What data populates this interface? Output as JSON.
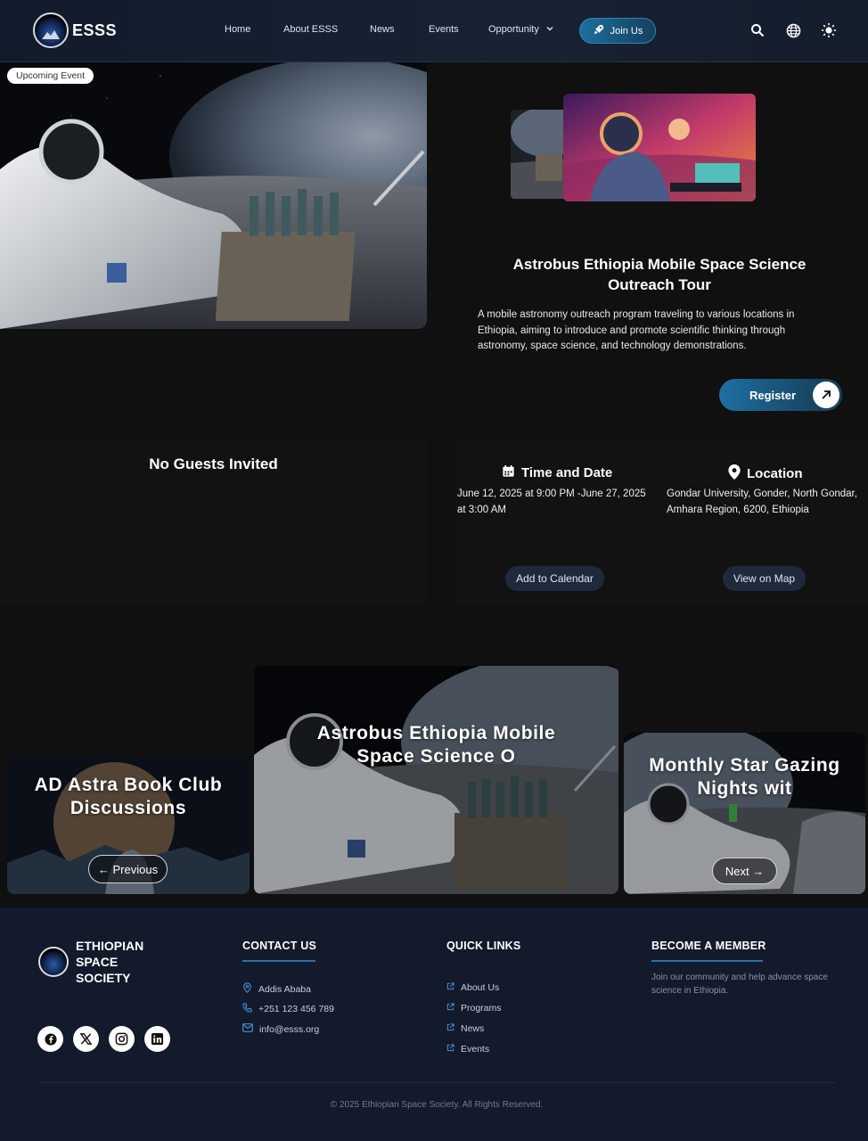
{
  "nav": {
    "brand": "ESSS",
    "links": [
      "Home",
      "About ESSS",
      "News",
      "Events",
      "Opportunity"
    ],
    "join_label": "Join Us",
    "icons": [
      "search-icon",
      "globe-icon",
      "sun-icon"
    ]
  },
  "hero": {
    "badge": "Upcoming Event",
    "title": "Astrobus Ethiopia Mobile Space Science Outreach Tour",
    "description": "A mobile astronomy outreach program traveling to various locations in Ethiopia, aiming to introduce and promote scientific thinking through astronomy, space science, and technology demonstrations.",
    "register_label": "Register"
  },
  "guests": {
    "title": "No Guests Invited"
  },
  "details": {
    "time_heading": "Time and Date",
    "time_value": "June 12, 2025 at 9:00 PM -June 27, 2025 at 3:00 AM",
    "location_heading": "Location",
    "location_value": "Gondar University, Gonder, North Gondar, Amhara Region, 6200, Ethiopia",
    "calendar_button": "Add to Calendar",
    "map_button": "View on Map"
  },
  "carousel": {
    "slides": [
      {
        "title": "AD Astra Book Club Discussions"
      },
      {
        "title": "Astrobus Ethiopia Mobile Space Science O"
      },
      {
        "title": "Monthly Star Gazing Nights wit"
      }
    ],
    "prev_label": "← Previous",
    "next_label": "Next →"
  },
  "footer": {
    "brand_line1": "ETHIOPIAN",
    "brand_line2": "SPACE",
    "brand_line3": "SOCIETY",
    "social": [
      "facebook-icon",
      "x-icon",
      "instagram-icon",
      "linkedin-icon"
    ],
    "contact_heading": "CONTACT US",
    "contact": {
      "address": "Addis Ababa",
      "phone": "+251 123 456 789",
      "email": "info@esss.org"
    },
    "links_heading": "QUICK LINKS",
    "links": [
      "About Us",
      "Programs",
      "News",
      "Events"
    ],
    "member_heading": "BECOME A MEMBER",
    "member_text": "Join our community and help advance space science in Ethiopia.",
    "copyright": "© 2025 Ethiopian Space Society. All Rights Reserved."
  },
  "colors": {
    "accent": "#1f6fa3",
    "nav_bg": "#172233",
    "footer_bg": "#121a2b",
    "page_bg": "#101010"
  }
}
